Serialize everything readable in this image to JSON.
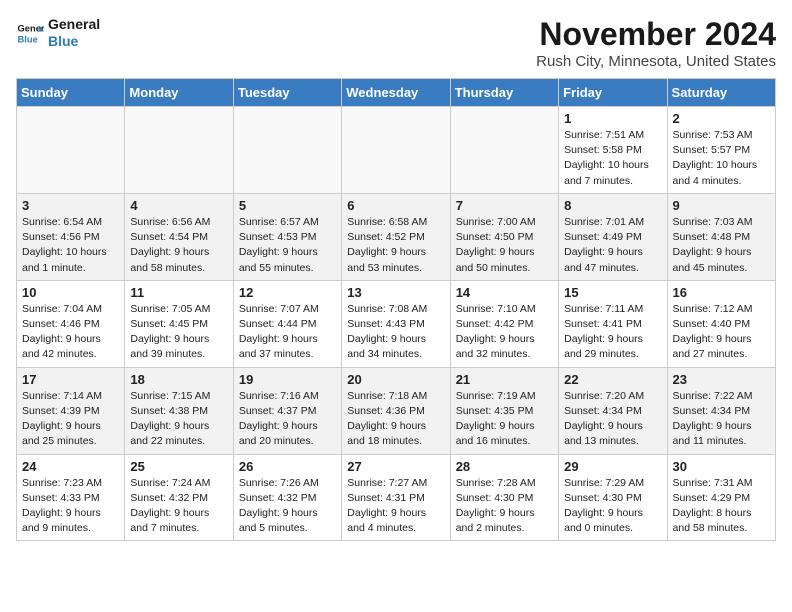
{
  "logo": {
    "line1": "General",
    "line2": "Blue"
  },
  "title": "November 2024",
  "location": "Rush City, Minnesota, United States",
  "weekdays": [
    "Sunday",
    "Monday",
    "Tuesday",
    "Wednesday",
    "Thursday",
    "Friday",
    "Saturday"
  ],
  "weeks": [
    [
      {
        "day": "",
        "detail": ""
      },
      {
        "day": "",
        "detail": ""
      },
      {
        "day": "",
        "detail": ""
      },
      {
        "day": "",
        "detail": ""
      },
      {
        "day": "",
        "detail": ""
      },
      {
        "day": "1",
        "detail": "Sunrise: 7:51 AM\nSunset: 5:58 PM\nDaylight: 10 hours\nand 7 minutes."
      },
      {
        "day": "2",
        "detail": "Sunrise: 7:53 AM\nSunset: 5:57 PM\nDaylight: 10 hours\nand 4 minutes."
      }
    ],
    [
      {
        "day": "3",
        "detail": "Sunrise: 6:54 AM\nSunset: 4:56 PM\nDaylight: 10 hours\nand 1 minute."
      },
      {
        "day": "4",
        "detail": "Sunrise: 6:56 AM\nSunset: 4:54 PM\nDaylight: 9 hours\nand 58 minutes."
      },
      {
        "day": "5",
        "detail": "Sunrise: 6:57 AM\nSunset: 4:53 PM\nDaylight: 9 hours\nand 55 minutes."
      },
      {
        "day": "6",
        "detail": "Sunrise: 6:58 AM\nSunset: 4:52 PM\nDaylight: 9 hours\nand 53 minutes."
      },
      {
        "day": "7",
        "detail": "Sunrise: 7:00 AM\nSunset: 4:50 PM\nDaylight: 9 hours\nand 50 minutes."
      },
      {
        "day": "8",
        "detail": "Sunrise: 7:01 AM\nSunset: 4:49 PM\nDaylight: 9 hours\nand 47 minutes."
      },
      {
        "day": "9",
        "detail": "Sunrise: 7:03 AM\nSunset: 4:48 PM\nDaylight: 9 hours\nand 45 minutes."
      }
    ],
    [
      {
        "day": "10",
        "detail": "Sunrise: 7:04 AM\nSunset: 4:46 PM\nDaylight: 9 hours\nand 42 minutes."
      },
      {
        "day": "11",
        "detail": "Sunrise: 7:05 AM\nSunset: 4:45 PM\nDaylight: 9 hours\nand 39 minutes."
      },
      {
        "day": "12",
        "detail": "Sunrise: 7:07 AM\nSunset: 4:44 PM\nDaylight: 9 hours\nand 37 minutes."
      },
      {
        "day": "13",
        "detail": "Sunrise: 7:08 AM\nSunset: 4:43 PM\nDaylight: 9 hours\nand 34 minutes."
      },
      {
        "day": "14",
        "detail": "Sunrise: 7:10 AM\nSunset: 4:42 PM\nDaylight: 9 hours\nand 32 minutes."
      },
      {
        "day": "15",
        "detail": "Sunrise: 7:11 AM\nSunset: 4:41 PM\nDaylight: 9 hours\nand 29 minutes."
      },
      {
        "day": "16",
        "detail": "Sunrise: 7:12 AM\nSunset: 4:40 PM\nDaylight: 9 hours\nand 27 minutes."
      }
    ],
    [
      {
        "day": "17",
        "detail": "Sunrise: 7:14 AM\nSunset: 4:39 PM\nDaylight: 9 hours\nand 25 minutes."
      },
      {
        "day": "18",
        "detail": "Sunrise: 7:15 AM\nSunset: 4:38 PM\nDaylight: 9 hours\nand 22 minutes."
      },
      {
        "day": "19",
        "detail": "Sunrise: 7:16 AM\nSunset: 4:37 PM\nDaylight: 9 hours\nand 20 minutes."
      },
      {
        "day": "20",
        "detail": "Sunrise: 7:18 AM\nSunset: 4:36 PM\nDaylight: 9 hours\nand 18 minutes."
      },
      {
        "day": "21",
        "detail": "Sunrise: 7:19 AM\nSunset: 4:35 PM\nDaylight: 9 hours\nand 16 minutes."
      },
      {
        "day": "22",
        "detail": "Sunrise: 7:20 AM\nSunset: 4:34 PM\nDaylight: 9 hours\nand 13 minutes."
      },
      {
        "day": "23",
        "detail": "Sunrise: 7:22 AM\nSunset: 4:34 PM\nDaylight: 9 hours\nand 11 minutes."
      }
    ],
    [
      {
        "day": "24",
        "detail": "Sunrise: 7:23 AM\nSunset: 4:33 PM\nDaylight: 9 hours\nand 9 minutes."
      },
      {
        "day": "25",
        "detail": "Sunrise: 7:24 AM\nSunset: 4:32 PM\nDaylight: 9 hours\nand 7 minutes."
      },
      {
        "day": "26",
        "detail": "Sunrise: 7:26 AM\nSunset: 4:32 PM\nDaylight: 9 hours\nand 5 minutes."
      },
      {
        "day": "27",
        "detail": "Sunrise: 7:27 AM\nSunset: 4:31 PM\nDaylight: 9 hours\nand 4 minutes."
      },
      {
        "day": "28",
        "detail": "Sunrise: 7:28 AM\nSunset: 4:30 PM\nDaylight: 9 hours\nand 2 minutes."
      },
      {
        "day": "29",
        "detail": "Sunrise: 7:29 AM\nSunset: 4:30 PM\nDaylight: 9 hours\nand 0 minutes."
      },
      {
        "day": "30",
        "detail": "Sunrise: 7:31 AM\nSunset: 4:29 PM\nDaylight: 8 hours\nand 58 minutes."
      }
    ]
  ]
}
